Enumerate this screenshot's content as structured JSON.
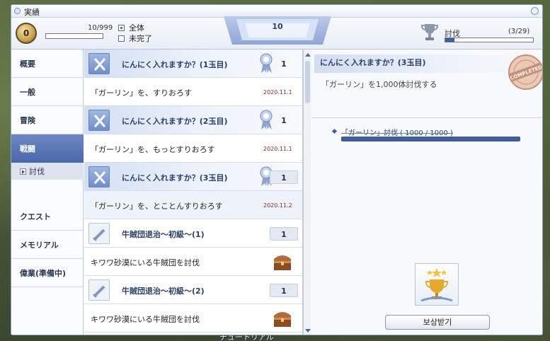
{
  "window": {
    "title": "実績"
  },
  "header": {
    "rank": "0",
    "score": "10/999",
    "filters": {
      "all": "全体",
      "incomplete": "未完了"
    },
    "center_value": "10",
    "category_label": "討伐",
    "category_count": "(3/29)",
    "category_progress": 0.103
  },
  "sidebar": {
    "items": [
      {
        "label": "概要"
      },
      {
        "label": "一般"
      },
      {
        "label": "冒険"
      },
      {
        "label": "戦闘"
      },
      {
        "label": "クエスト"
      },
      {
        "label": "メモリアル"
      },
      {
        "label": "偉業(準備中)"
      }
    ],
    "sub_item": {
      "label": "討伐"
    }
  },
  "list": {
    "entries": [
      {
        "title": "にんにく入れますか？(1玉目)",
        "points": "1",
        "desc": "「ガーリン」を、すりおろす",
        "date": "2020.11.1"
      },
      {
        "title": "にんにく入れますか？(2玉目)",
        "points": "1",
        "desc": "「ガーリン」を、もっとすりおろす",
        "date": "2020.11.1"
      },
      {
        "title": "にんにく入れますか？(3玉目)",
        "points": "1",
        "desc": "「ガーリン」を、とことんすりおろす",
        "date": "2020.11.2"
      },
      {
        "title": "牛賊団退治～初級～(1)",
        "points": "1",
        "desc": "キワワ砂漠にいる牛賊団を討伐"
      },
      {
        "title": "牛賊団退治～初級～(2)",
        "points": "1",
        "desc": "キワワ砂漠にいる牛賊団を討伐"
      }
    ]
  },
  "detail": {
    "title": "にんにく入れますか？(3玉目)",
    "description": "「ガーリン」を1,000体討伐する",
    "requirement": "「ガーリン」討伐 ( 1000 / 1000 )",
    "stamp": "COMPLETED",
    "claim_button": "보상받기"
  },
  "background": {
    "bottom_text": "チュートリアル"
  },
  "colors": {
    "accent": "#4b67a9",
    "progress": "#3d5d9c",
    "date": "#8a2a2a"
  }
}
